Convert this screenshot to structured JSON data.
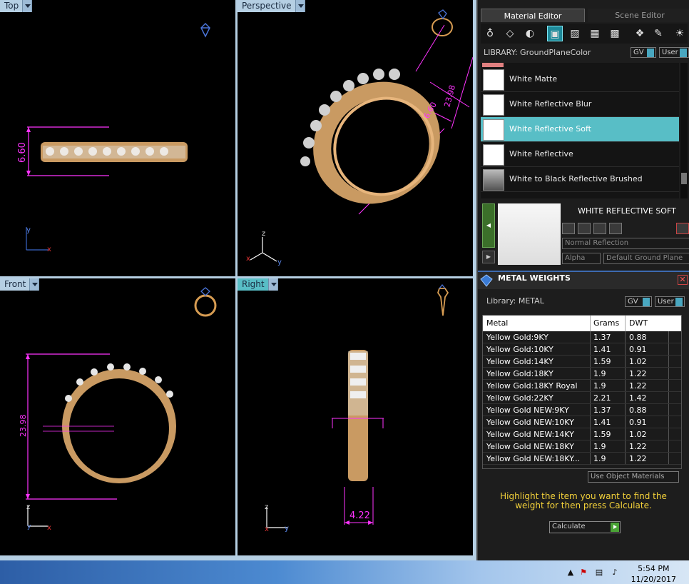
{
  "viewports": {
    "top": {
      "label": "Top",
      "dim": "6.60"
    },
    "perspective": {
      "label": "Perspective",
      "dim_a": "6.60",
      "dim_b": "23.98"
    },
    "front": {
      "label": "Front",
      "dim": "23.98"
    },
    "right": {
      "label": "Right",
      "dim": "4.22"
    }
  },
  "panel": {
    "tabs": [
      "Material Editor",
      "Scene Editor"
    ],
    "library_label": "LIBRARY: GroundPlaneColor",
    "gv": "GV",
    "user": "User",
    "materials": [
      {
        "name": "White Matte",
        "selected": false
      },
      {
        "name": "White Reflective Blur",
        "selected": false
      },
      {
        "name": "White Reflective Soft",
        "selected": true
      },
      {
        "name": "White Reflective",
        "selected": false
      },
      {
        "name": "White to Black Reflective Brushed",
        "selected": false
      }
    ],
    "material_title": "WHITE REFLECTIVE SOFT",
    "reflection_mode": "Normal Reflection",
    "alpha_label": "Alpha",
    "ground_plane": "Default Ground Plane",
    "accent_color": "#58bec6"
  },
  "metal_weights": {
    "title": "METAL WEIGHTS",
    "library_label": "Library: METAL",
    "gv": "GV",
    "user": "User",
    "columns": [
      "Metal",
      "Grams",
      "DWT"
    ],
    "rows": [
      [
        "Yellow Gold:9KY",
        "1.37",
        "0.88"
      ],
      [
        "Yellow Gold:10KY",
        "1.41",
        "0.91"
      ],
      [
        "Yellow Gold:14KY",
        "1.59",
        "1.02"
      ],
      [
        "Yellow Gold:18KY",
        "1.9",
        "1.22"
      ],
      [
        "Yellow Gold:18KY Royal",
        "1.9",
        "1.22"
      ],
      [
        "Yellow Gold:22KY",
        "2.21",
        "1.42"
      ],
      [
        "Yellow Gold NEW:9KY",
        "1.37",
        "0.88"
      ],
      [
        "Yellow Gold NEW:10KY",
        "1.41",
        "0.91"
      ],
      [
        "Yellow Gold NEW:14KY",
        "1.59",
        "1.02"
      ],
      [
        "Yellow Gold NEW:18KY",
        "1.9",
        "1.22"
      ],
      [
        "Yellow Gold NEW:18KY...",
        "1.9",
        "1.22"
      ]
    ],
    "use_object_materials": "Use Object Materials",
    "instruction": "Highlight the item you want to find the weight for then press Calculate.",
    "calculate": "Calculate"
  },
  "taskbar": {
    "time": "5:54 PM",
    "date": "11/20/2017"
  }
}
